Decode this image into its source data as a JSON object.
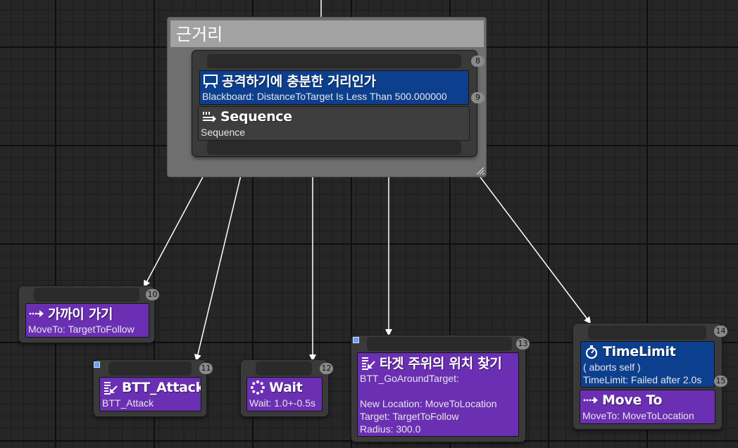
{
  "comment": {
    "title": "근거리"
  },
  "nodes": {
    "root": {
      "index": "8",
      "decorator": {
        "title": "공격하기에 충분한 거리인가",
        "sub": "Blackboard: DistanceToTarget Is Less Than 500.000000",
        "index": "9",
        "icon": "blackboard-icon"
      },
      "composite": {
        "title": "Sequence",
        "sub": "Sequence",
        "icon": "sequence-icon"
      }
    },
    "moveto_close": {
      "index": "10",
      "title": "가까이 가기",
      "sub": "MoveTo: TargetToFollow",
      "icon": "move-to-icon"
    },
    "btt_attack": {
      "index": "11",
      "title": "BTT_Attack",
      "sub": "BTT_Attack",
      "icon": "task-icon"
    },
    "wait": {
      "index": "12",
      "title": "Wait",
      "sub": "Wait: 1.0+-0.5s",
      "icon": "wait-icon"
    },
    "find_location": {
      "index": "13",
      "title": "타겟 주위의 위치 찾기",
      "sub": "BTT_GoAroundTarget:\n\nNew Location: MoveToLocation\nTarget: TargetToFollow\nRadius: 300.0",
      "icon": "task-icon"
    },
    "timelimit_moveto": {
      "index": "14",
      "decorator": {
        "title": "TimeLimit",
        "sub": "( aborts self )\nTimeLimit: Failed after 2.0s",
        "index": "15",
        "icon": "stopwatch-icon"
      },
      "task": {
        "title": "Move To",
        "sub": "MoveTo: MoveToLocation",
        "icon": "move-to-icon"
      }
    }
  },
  "colors": {
    "task": "#6a2fb3",
    "decorator": "#0d3f8f",
    "composite": "#3e3e3e",
    "grid_bg": "#262626",
    "wire": "#ffffff"
  }
}
